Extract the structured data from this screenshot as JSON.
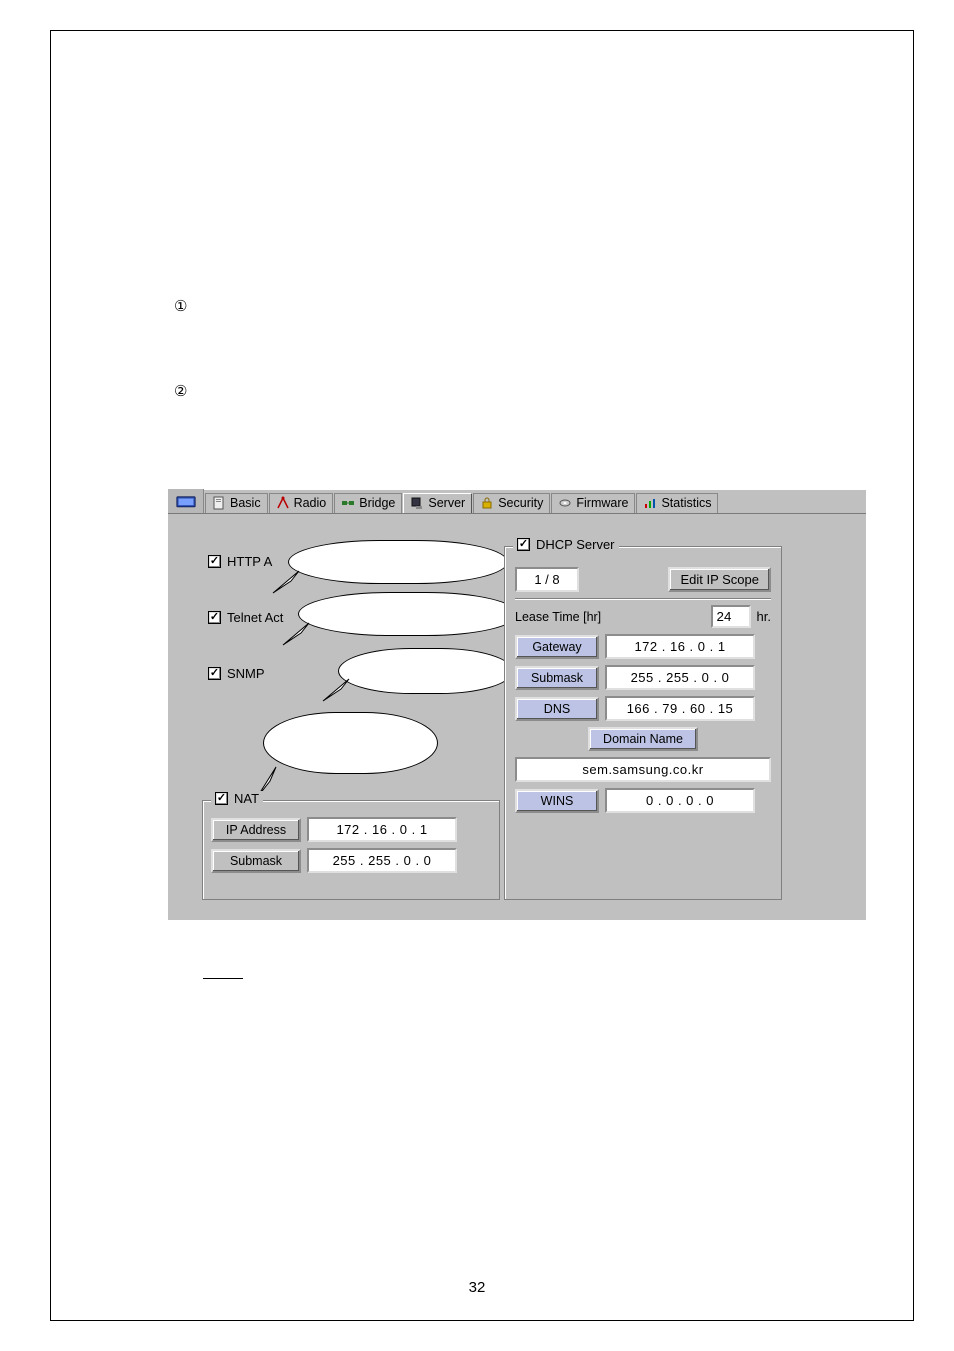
{
  "markers": {
    "one": "①",
    "two": "②"
  },
  "page_number": "32",
  "tabs": [
    {
      "label": "Basic"
    },
    {
      "label": "Radio"
    },
    {
      "label": "Bridge"
    },
    {
      "label": "Server"
    },
    {
      "label": "Security"
    },
    {
      "label": "Firmware"
    },
    {
      "label": "Statistics"
    }
  ],
  "left": {
    "http": {
      "label": "HTTP A",
      "checked": true
    },
    "telnet": {
      "label": "Telnet Act",
      "checked": true
    },
    "snmp": {
      "label": "SNMP",
      "checked": true
    },
    "nat": {
      "label": "NAT",
      "checked": true,
      "ip_label": "IP Address",
      "ip_value": "172 . 16  .  0  .  1",
      "submask_label": "Submask",
      "submask_value": "255 . 255 .  0  .  0"
    }
  },
  "dhcp": {
    "label": "DHCP Server",
    "checked": true,
    "scope": "1 / 8",
    "edit_scope": "Edit IP Scope",
    "lease_label": "Lease Time [hr]",
    "lease_value": "24",
    "lease_unit": "hr.",
    "gateway_label": "Gateway",
    "gateway_value": "172 . 16  .  0  .  1",
    "submask_label": "Submask",
    "submask_value": "255 . 255 .  0  .  0",
    "dns_label": "DNS",
    "dns_value": "166 . 79  . 60  . 15",
    "domain_label": "Domain Name",
    "domain_value": "sem.samsung.co.kr",
    "wins_label": "WINS",
    "wins_value": "0  .  0  .  0  .  0"
  }
}
